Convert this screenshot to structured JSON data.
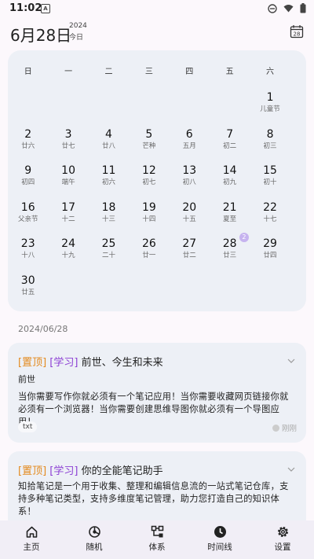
{
  "status_bar": {
    "time": "11:02",
    "app_icon_letter": "A"
  },
  "header": {
    "date": "6月28日",
    "year": "2024",
    "today_label": "今日",
    "calendar_button_day": "28"
  },
  "calendar": {
    "weekdays": [
      "日",
      "一",
      "二",
      "三",
      "四",
      "五",
      "六"
    ],
    "weeks": [
      [
        null,
        null,
        null,
        null,
        null,
        null,
        {
          "num": "1",
          "lunar": "儿童节"
        }
      ],
      [
        {
          "num": "2",
          "lunar": "廿六"
        },
        {
          "num": "3",
          "lunar": "廿七"
        },
        {
          "num": "4",
          "lunar": "廿八"
        },
        {
          "num": "5",
          "lunar": "芒种"
        },
        {
          "num": "6",
          "lunar": "五月"
        },
        {
          "num": "7",
          "lunar": "初二"
        },
        {
          "num": "8",
          "lunar": "初三"
        }
      ],
      [
        {
          "num": "9",
          "lunar": "初四"
        },
        {
          "num": "10",
          "lunar": "端午"
        },
        {
          "num": "11",
          "lunar": "初六"
        },
        {
          "num": "12",
          "lunar": "初七"
        },
        {
          "num": "13",
          "lunar": "初八"
        },
        {
          "num": "14",
          "lunar": "初九"
        },
        {
          "num": "15",
          "lunar": "初十"
        }
      ],
      [
        {
          "num": "16",
          "lunar": "父亲节"
        },
        {
          "num": "17",
          "lunar": "十二"
        },
        {
          "num": "18",
          "lunar": "十三"
        },
        {
          "num": "19",
          "lunar": "十四"
        },
        {
          "num": "20",
          "lunar": "十五"
        },
        {
          "num": "21",
          "lunar": "夏至"
        },
        {
          "num": "22",
          "lunar": "十七"
        }
      ],
      [
        {
          "num": "23",
          "lunar": "十八"
        },
        {
          "num": "24",
          "lunar": "十九"
        },
        {
          "num": "25",
          "lunar": "二十"
        },
        {
          "num": "26",
          "lunar": "廿一"
        },
        {
          "num": "27",
          "lunar": "廿二"
        },
        {
          "num": "28",
          "lunar": "廿三",
          "badge": "2"
        },
        {
          "num": "29",
          "lunar": "廿四"
        }
      ],
      [
        {
          "num": "30",
          "lunar": "廿五"
        },
        null,
        null,
        null,
        null,
        null,
        null
      ]
    ],
    "badge_color": "#c6b3ef"
  },
  "list_date": "2024/06/28",
  "notes": [
    {
      "tag_top": "[置顶]",
      "tag_study": "[学习]",
      "title": "前世、今生和未来",
      "subtitle": "前世",
      "body": "当你需要写作你就必须有一个笔记应用！当你需要收藏网页链接你就必须有一个浏览器！当你需要创建思维导图你就必须有一个导图应用！",
      "ext": "txt",
      "time": "刚刚"
    },
    {
      "tag_top": "[置顶]",
      "tag_study": "[学习]",
      "title": "你的全能笔记助手",
      "body": "知拾笔记是一个用于收集、整理和编辑信息流的一站式笔记仓库，支持多种笔记类型，支持多维度笔记管理，助力您打造自己的知识体系！"
    }
  ],
  "nav": [
    {
      "label": "主页",
      "icon": "home-icon"
    },
    {
      "label": "随机",
      "icon": "random-icon"
    },
    {
      "label": "体系",
      "icon": "hierarchy-icon"
    },
    {
      "label": "时间线",
      "icon": "clock-icon"
    },
    {
      "label": "设置",
      "icon": "gear-icon"
    }
  ],
  "colors": {
    "tag_top": "#e38a1e",
    "tag_study": "#8c3fd4",
    "card_bg": "#edf0f6",
    "page_bg": "#fcf8fc"
  }
}
